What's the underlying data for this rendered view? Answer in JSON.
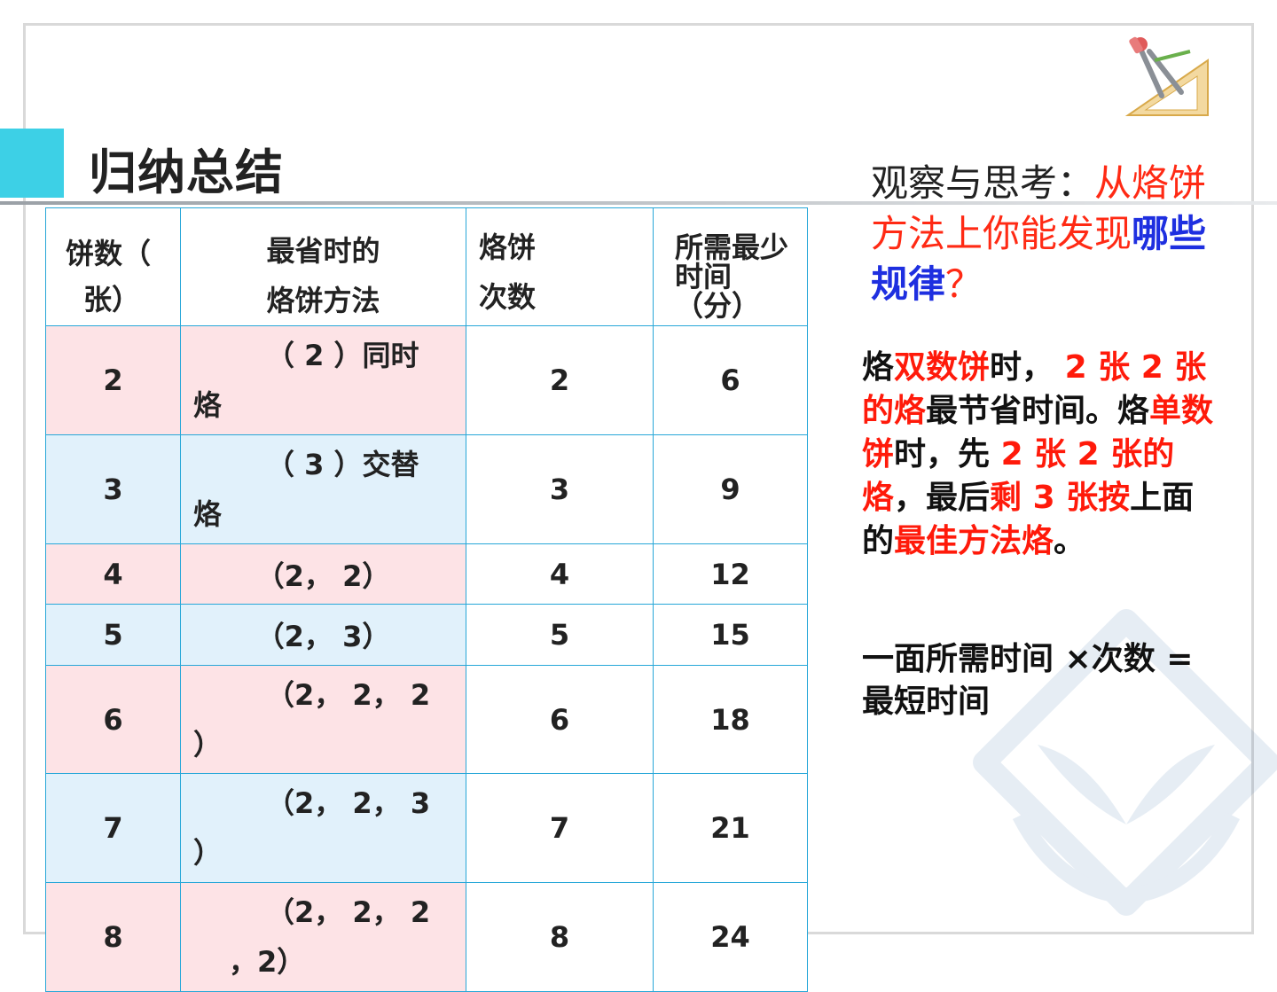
{
  "slide": {
    "title": "归纳总结",
    "colors": {
      "accent": "#3dd0e6",
      "table_border": "#27a7d8",
      "pink_row": "#fde3e6",
      "blue_row": "#e1f1fb",
      "red_text": "#ff2a14",
      "blue_text": "#1e2fe0"
    }
  },
  "table": {
    "headers": {
      "count_line1": "饼数（",
      "count_line2": "张）",
      "method_line1": "最省时的",
      "method_line2": "烙饼方法",
      "times_line1": "烙饼",
      "times_line2": "次数",
      "minutes_line1": "所需最少",
      "minutes_line2": "时间",
      "minutes_line3": "（分）"
    },
    "rows": [
      {
        "count": "2",
        "method_line1": "（ 2 ）同时",
        "method_line2": "烙",
        "times": "2",
        "minutes": "6"
      },
      {
        "count": "3",
        "method_line1": "（ 3 ）交替",
        "method_line2": "烙",
        "times": "3",
        "minutes": "9"
      },
      {
        "count": "4",
        "method": "（2， 2）",
        "times": "4",
        "minutes": "12"
      },
      {
        "count": "5",
        "method": "（2， 3）",
        "times": "5",
        "minutes": "15"
      },
      {
        "count": "6",
        "method_line1": "（2， 2， 2",
        "method_line2": "）",
        "times": "6",
        "minutes": "18"
      },
      {
        "count": "7",
        "method_line1": "（2， 2， 3",
        "method_line2": "）",
        "times": "7",
        "minutes": "21"
      },
      {
        "count": "8",
        "method_line1": "（2， 2， 2",
        "method_line2": "，2）",
        "times": "8",
        "minutes": "24"
      }
    ]
  },
  "sidebar": {
    "question_prefix": "观察与思考：",
    "question_red": "从烙饼方法上你能发现",
    "question_blue": "哪些规律",
    "question_mark": "？",
    "answer": {
      "p1": "烙",
      "p2": "双数饼",
      "p3": "时， ",
      "p4": "2 张 2 张的烙",
      "p5": "最节省时间。烙",
      "p6": "单数饼",
      "p7": "时，先 ",
      "p8": "2 张 2 张的烙",
      "p9": "，最后",
      "p10": "剩 3 张按",
      "p11": "上面的",
      "p12": "最佳方法烙",
      "p13": "。"
    },
    "formula_line1": "一面所需时间 ×次数 =",
    "formula_line2": "最短时间"
  },
  "icons": [
    "compass-ruler-logo-icon",
    "seedling-hands-watermark-icon"
  ]
}
